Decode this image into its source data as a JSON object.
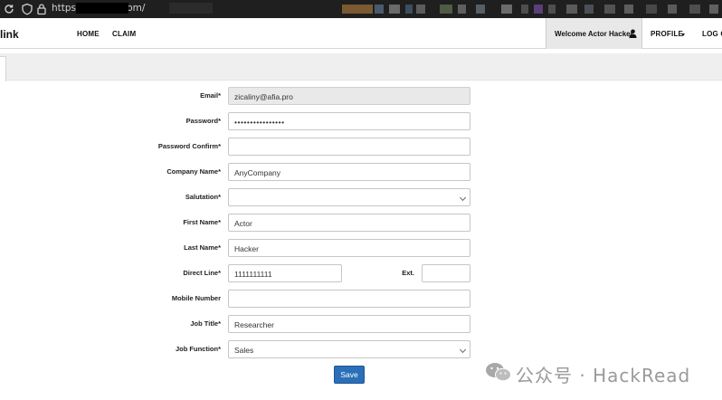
{
  "browser": {
    "url": "https://            tp-link.com/"
  },
  "site": {
    "logo_text": "link",
    "nav": {
      "home": "HOME",
      "claim": "CLAIM",
      "welcome": "Welcome Actor Hacker",
      "profile": "PROFILE",
      "logout": "LOG O"
    }
  },
  "form": {
    "email_label": "Email*",
    "email_value": "zicaliny@afia.pro",
    "password_label": "Password*",
    "password_value": "••••••••••••••••",
    "password_confirm_label": "Password Confirm*",
    "password_confirm_value": "",
    "company_label": "Company Name*",
    "company_value": "AnyCompany",
    "salutation_label": "Salutation*",
    "salutation_value": "",
    "first_name_label": "First Name*",
    "first_name_value": "Actor",
    "last_name_label": "Last Name*",
    "last_name_value": "Hacker",
    "direct_line_label": "Direct Line*",
    "direct_line_value": "1111111111",
    "ext_label": "Ext.",
    "ext_value": "",
    "mobile_label": "Mobile Number",
    "mobile_value": "",
    "job_title_label": "Job Title*",
    "job_title_value": "Researcher",
    "job_function_label": "Job Function*",
    "job_function_value": "Sales",
    "save_label": "Save"
  },
  "watermark": {
    "text": "公众号 · HackRead"
  }
}
